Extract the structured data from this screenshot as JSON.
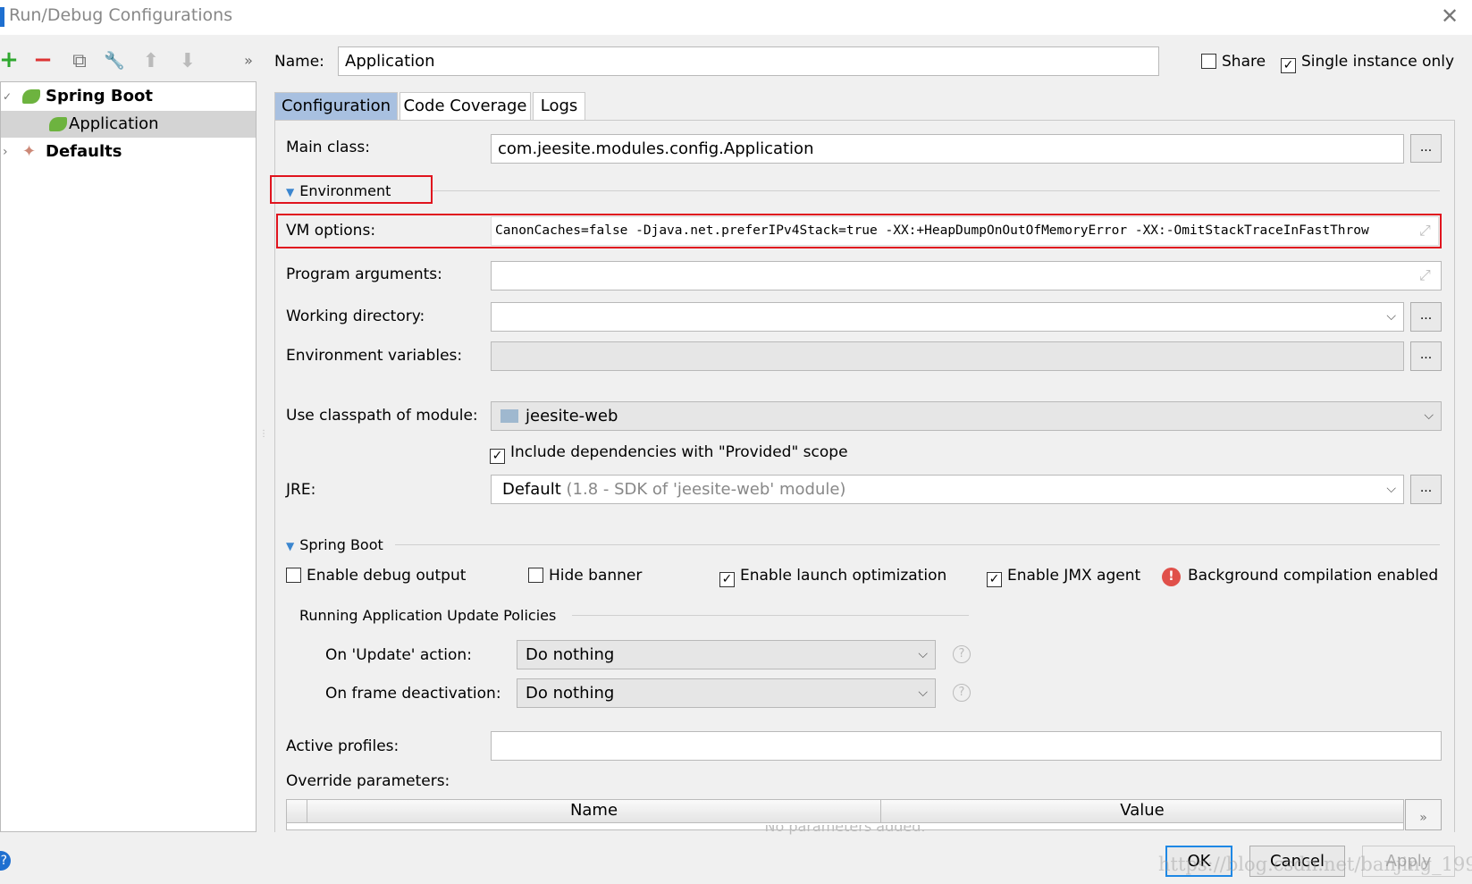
{
  "window": {
    "title": "Run/Debug Configurations",
    "close": "✕"
  },
  "toolbar": {
    "add": "+",
    "remove": "−",
    "copy": "⧉",
    "edit_defaults": "🔧",
    "move_up": "⬆",
    "move_down": "⬇",
    "more": "»"
  },
  "tree": {
    "items": [
      {
        "label": "Spring Boot",
        "expander": "✓"
      },
      {
        "label": "Application",
        "selected": true
      },
      {
        "label": "Defaults",
        "expander": "›"
      }
    ]
  },
  "name": {
    "label": "Name:",
    "value": "Application"
  },
  "share": {
    "label": "Share",
    "checked": false
  },
  "single_instance": {
    "label": "Single instance only",
    "checked": true
  },
  "tabs": [
    {
      "label": "Configuration",
      "active": true
    },
    {
      "label": "Code Coverage"
    },
    {
      "label": "Logs"
    }
  ],
  "config": {
    "main_class": {
      "label": "Main class:",
      "value": "com.jeesite.modules.config.Application",
      "button": "..."
    },
    "environment": {
      "label": "Environment"
    },
    "vm_options": {
      "label": "VM options:",
      "value": "CanonCaches=false -Djava.net.preferIPv4Stack=true -XX:+HeapDumpOnOutOfMemoryError -XX:-OmitStackTraceInFastThrow"
    },
    "program_arguments": {
      "label": "Program arguments:",
      "value": ""
    },
    "working_directory": {
      "label": "Working directory:",
      "value": "",
      "button": "..."
    },
    "environment_variables": {
      "label": "Environment variables:",
      "value": "",
      "button": "..."
    },
    "classpath_module": {
      "label": "Use classpath of module:",
      "value": "jeesite-web"
    },
    "include_provided": {
      "label": "Include dependencies with \"Provided\" scope",
      "checked": true
    },
    "jre": {
      "label": "JRE:",
      "value": "Default",
      "detail": "(1.8 - SDK of 'jeesite-web' module)",
      "button": "..."
    },
    "spring_boot": {
      "label": "Spring Boot",
      "options": [
        {
          "label": "Enable debug output",
          "checked": false
        },
        {
          "label": "Hide banner",
          "checked": false
        },
        {
          "label": "Enable launch optimization",
          "checked": true
        },
        {
          "label": "Enable JMX agent",
          "checked": true
        }
      ],
      "warning": "Background compilation enabled",
      "policies_label": "Running Application Update Policies",
      "on_update": {
        "label": "On 'Update' action:",
        "value": "Do nothing"
      },
      "on_frame": {
        "label": "On frame deactivation:",
        "value": "Do nothing"
      },
      "help": "?"
    },
    "active_profiles": {
      "label": "Active profiles:",
      "value": ""
    },
    "override": {
      "label": "Override parameters:",
      "columns": [
        "Name",
        "Value"
      ],
      "empty": "No parameters added.",
      "more": "»"
    }
  },
  "footer": {
    "ok": "OK",
    "cancel": "Cancel",
    "apply": "Apply",
    "help": "?",
    "watermark": "https://blog.csdn.net/banjing_1993"
  },
  "colors": {
    "accent": "#3b86cf",
    "highlight_box": "#e0141e",
    "tab_active": "#a8c0e0",
    "selection": "#d4d4d4"
  }
}
